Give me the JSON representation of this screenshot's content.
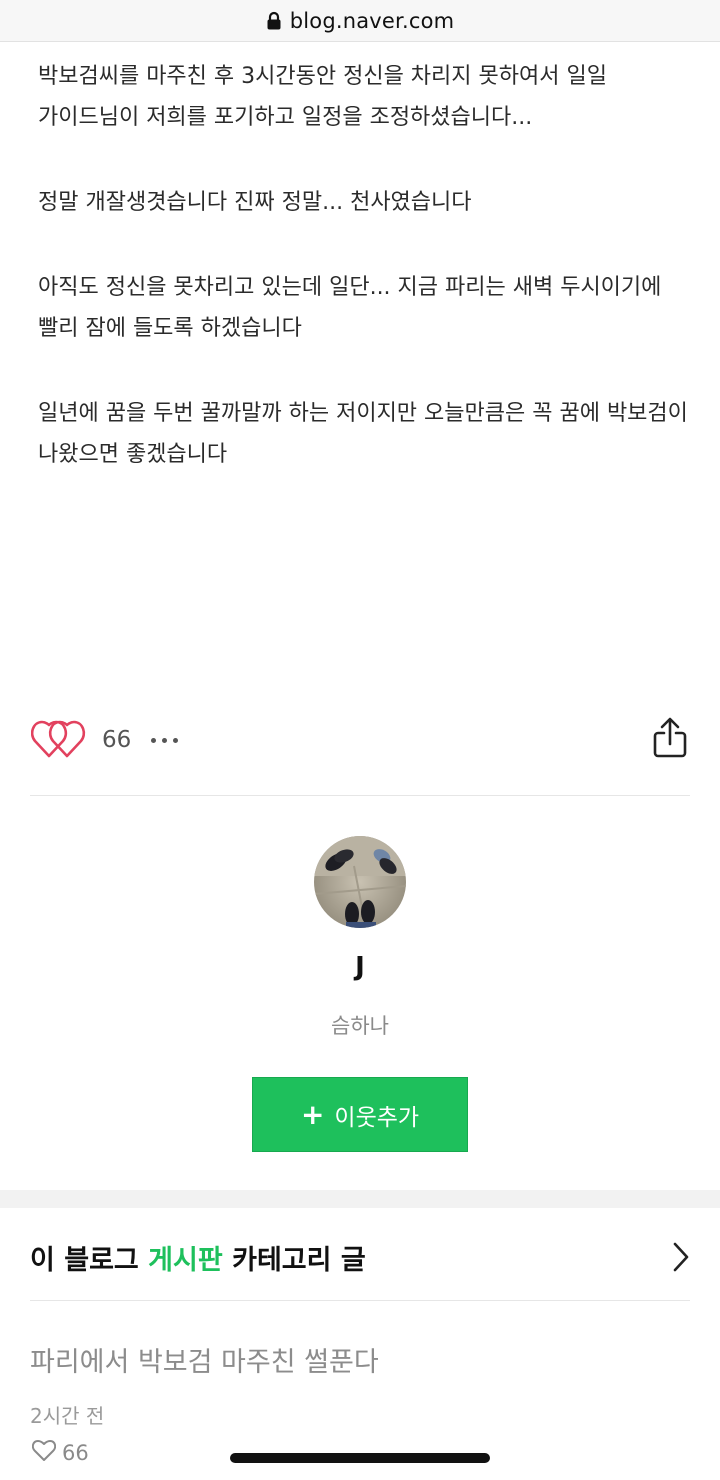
{
  "browser": {
    "domain": "blog.naver.com",
    "lock_icon": "lock-icon"
  },
  "post": {
    "paragraphs": [
      "박보검씨를 마주친 후 3시간동안 정신을 차리지 못하여서 일일 가이드님이 저희를 포기하고 일정을 조정하셨습니다...",
      "정말 개잘생겻습니다 진짜 정말... 천사였습니다",
      "아직도 정신을 못차리고 있는데 일단... 지금 파리는 새벽 두시이기에 빨리 잠에 들도록 하겠습니다",
      "일년에 꿈을 두번 꿀까말까 하는 저이지만 오늘만큼은 꼭 꿈에 박보검이 나왔으면 좋겠습니다"
    ]
  },
  "reactions": {
    "like_count": "66",
    "heart_color": "#e2415e",
    "icons": [
      "heart-icon",
      "more-icon",
      "share-icon"
    ]
  },
  "profile": {
    "nickname": "J",
    "subname": "슴하나",
    "add_neighbor_label": "이웃추가",
    "add_neighbor_color": "#1ec05c"
  },
  "category": {
    "prefix": "이 블로그 ",
    "name": "게시판",
    "suffix": " 카테고리 글",
    "accent_color": "#1ec05c"
  },
  "related_post": {
    "title": "파리에서 박보검 마주친 썰푼다",
    "time": "2시간 전",
    "likes": "66"
  }
}
